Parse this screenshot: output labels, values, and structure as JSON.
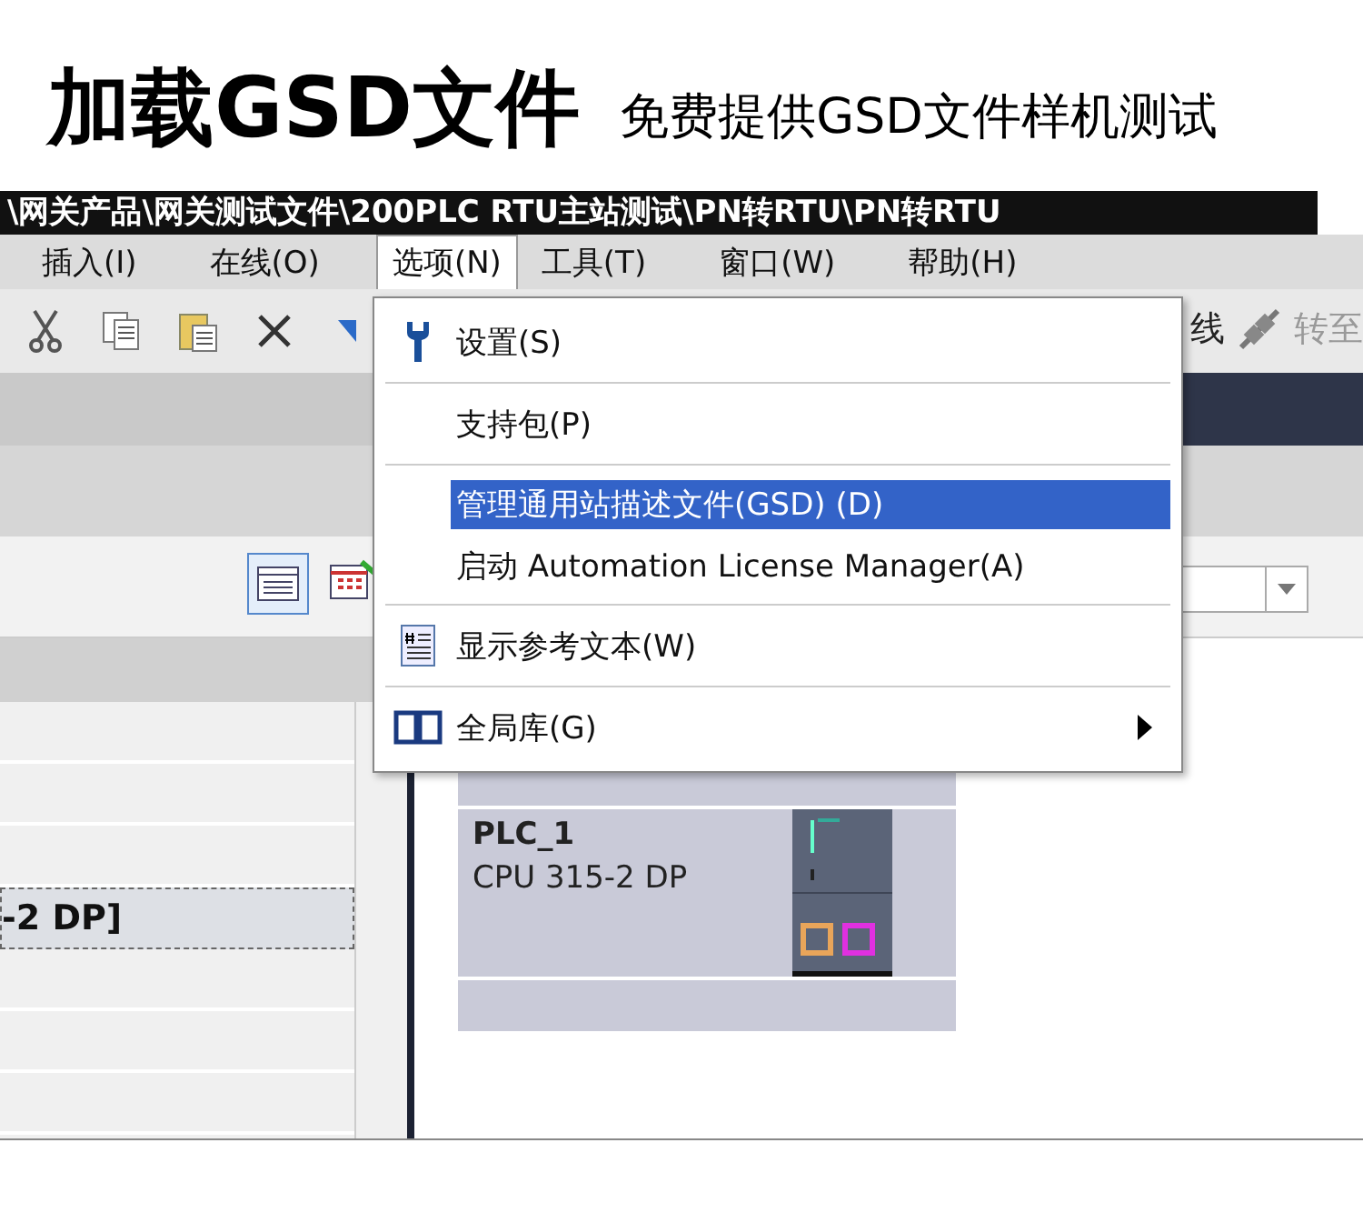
{
  "banner": {
    "title": "加载GSD文件",
    "subtitle": "免费提供GSD文件样机测试"
  },
  "window": {
    "title": "\\网关产品\\网关测试文件\\200PLC RTU主站测试\\PN转RTU\\PN转RTU"
  },
  "menu_bar": [
    {
      "label": "插入(I)",
      "selected": false
    },
    {
      "label": "在线(O)",
      "selected": false
    },
    {
      "label": "选项(N)",
      "selected": true
    },
    {
      "label": "工具(T)",
      "selected": false
    },
    {
      "label": "窗口(W)",
      "selected": false
    },
    {
      "label": "帮助(H)",
      "selected": false
    }
  ],
  "toolbar": {
    "texts": [
      "线",
      "转至"
    ]
  },
  "options_menu": {
    "groups": [
      [
        {
          "label": "设置(S)",
          "selected": false,
          "submenu": false
        }
      ],
      [
        {
          "label": "支持包(P)",
          "selected": false,
          "submenu": false
        }
      ],
      [
        {
          "label": "管理通用站描述文件(GSD) (D)",
          "selected": true,
          "submenu": false
        },
        {
          "label": "启动 Automation License Manager(A)",
          "selected": false,
          "submenu": false
        }
      ],
      [
        {
          "label": "显示参考文本(W)",
          "selected": false,
          "submenu": false
        }
      ],
      [
        {
          "label": "全局库(G)",
          "selected": false,
          "submenu": true
        }
      ]
    ]
  },
  "project_tree": {
    "rows": [
      {
        "label": "-2 DP]",
        "selected": true
      }
    ]
  },
  "device": {
    "name": "PLC_1",
    "type": "CPU 315-2 DP"
  }
}
